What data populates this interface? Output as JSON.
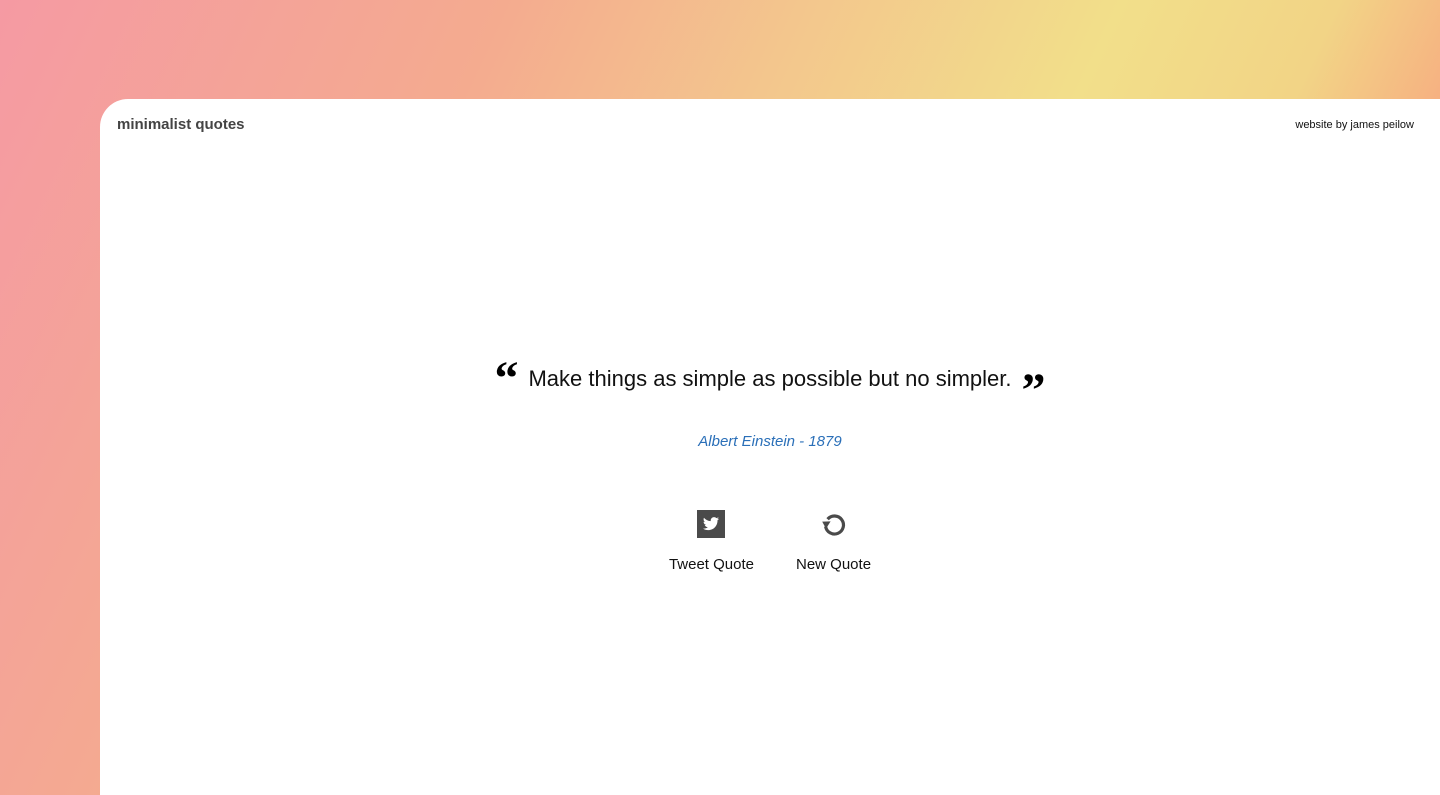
{
  "header": {
    "brand": "minimalist quotes",
    "credit": "website by james peilow"
  },
  "quote": {
    "open_mark": "“",
    "text": "Make things as simple as possible but no simpler.",
    "close_mark": "”",
    "author_line": "Albert Einstein - 1879"
  },
  "actions": {
    "tweet_label": "Tweet Quote",
    "tweet_icon": "twitter-icon",
    "new_label": "New Quote",
    "new_icon": "refresh-icon"
  },
  "colors": {
    "author": "#2a6fb8",
    "icon": "#4a4a4a"
  }
}
